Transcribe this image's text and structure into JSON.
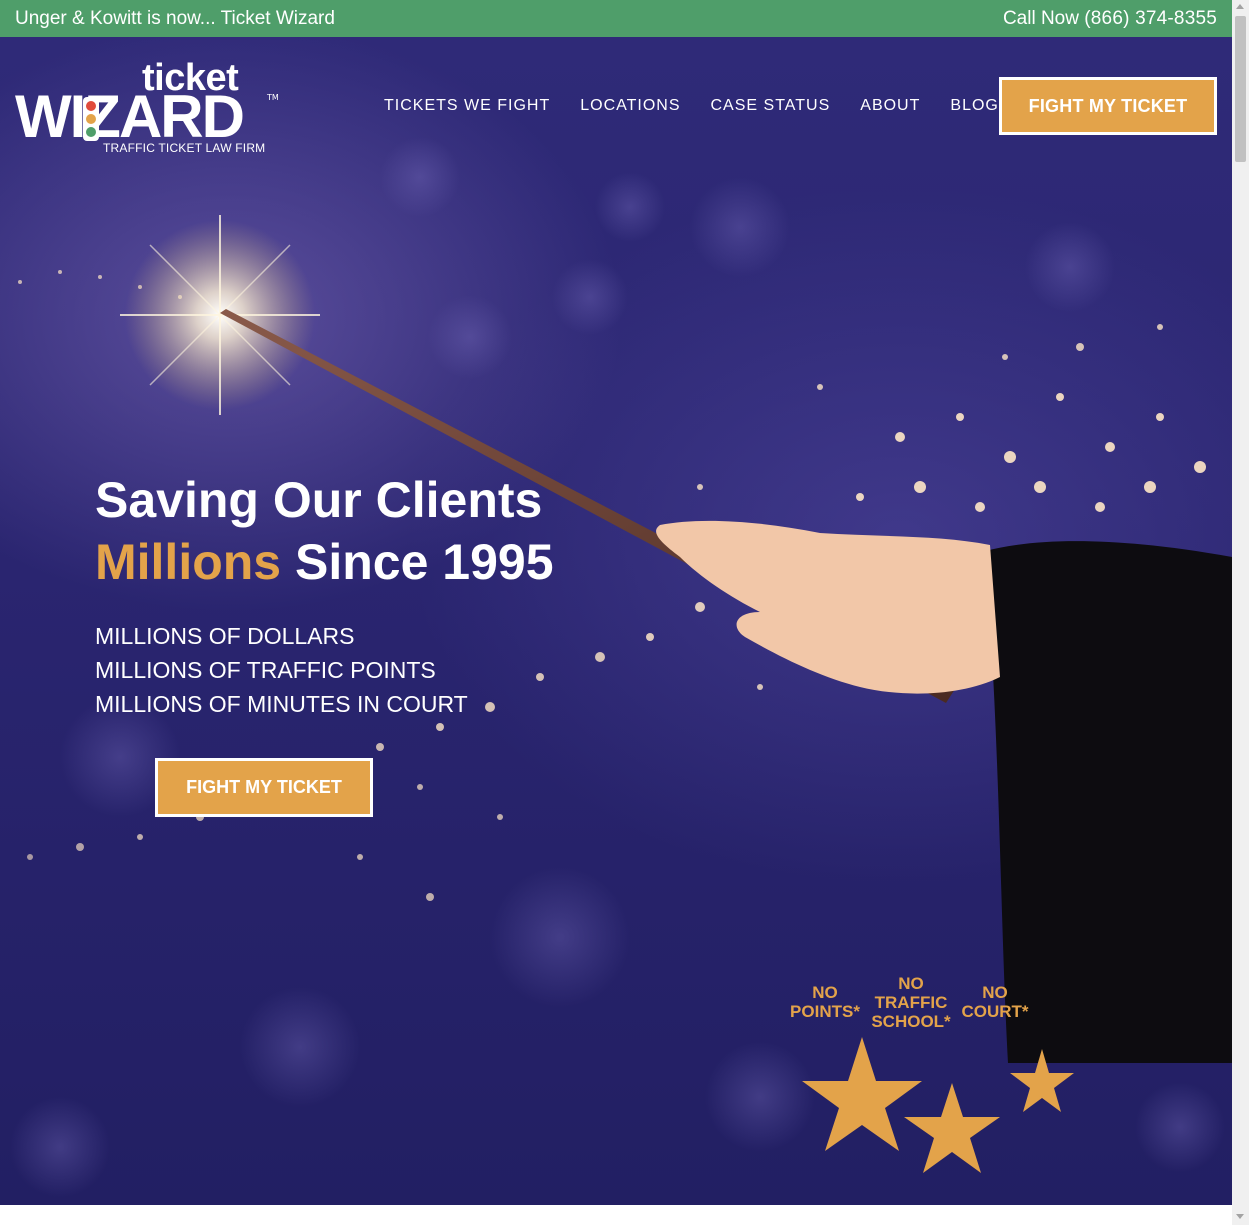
{
  "topbar": {
    "notice": "Unger & Kowitt is now... Ticket Wizard",
    "call_label": "Call Now",
    "phone": "(866) 374-8355"
  },
  "logo": {
    "line1": "ticket",
    "line2": "WIZARD",
    "tm": "TM",
    "tagline": "TRAFFIC TICKET LAW FIRM"
  },
  "nav": {
    "items": [
      "TICKETS WE FIGHT",
      "LOCATIONS",
      "CASE STATUS",
      "ABOUT",
      "BLOG"
    ]
  },
  "header_cta": "FIGHT MY TICKET",
  "hero": {
    "headline_line1": "Saving Our Clients",
    "headline_accent": "Millions",
    "headline_rest": "Since 1995",
    "bullets": [
      "MILLIONS OF DOLLARS",
      "MILLIONS OF TRAFFIC POINTS",
      "MILLIONS OF MINUTES IN COURT"
    ],
    "cta": "FIGHT MY TICKET"
  },
  "badges": [
    {
      "line1": "NO",
      "line2": "POINTS*"
    },
    {
      "line1": "NO",
      "line2": "TRAFFIC",
      "line3": "SCHOOL*"
    },
    {
      "line1": "NO",
      "line2": "COURT*"
    }
  ],
  "colors": {
    "topbar_green": "#4f9e6a",
    "accent_orange": "#e3a34a",
    "hero_purple": "#2a2570",
    "robe_black": "#0d0c10"
  }
}
